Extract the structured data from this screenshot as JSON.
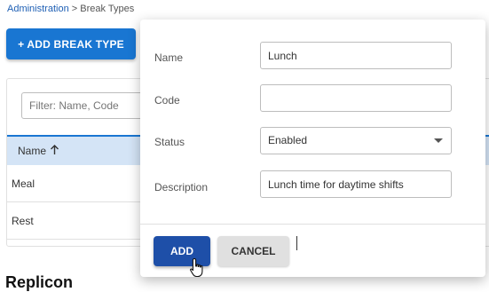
{
  "breadcrumb": {
    "root": "Administration",
    "separator": ">",
    "current": "Break Types"
  },
  "toolbar": {
    "add_break_type_label": "+ ADD BREAK TYPE"
  },
  "filter": {
    "placeholder": "Filter: Name, Code"
  },
  "table": {
    "columns": [
      {
        "label": "Name",
        "sort": "ascending",
        "sort_icon": "arrow-up-icon"
      }
    ],
    "rows": [
      {
        "name": "Meal"
      },
      {
        "name": "Rest"
      }
    ]
  },
  "footer": {
    "logo_text": "Replicon"
  },
  "modal": {
    "fields": {
      "name": {
        "label": "Name",
        "value": "Lunch"
      },
      "code": {
        "label": "Code",
        "value": ""
      },
      "status": {
        "label": "Status",
        "value": "Enabled"
      },
      "description": {
        "label": "Description",
        "value": "Lunch time for daytime shifts"
      }
    },
    "actions": {
      "add_label": "ADD",
      "cancel_label": "CANCEL"
    }
  },
  "colors": {
    "primary": "#1976d2",
    "add_button": "#1e4fa8",
    "header_bg": "#d4e4f6"
  }
}
